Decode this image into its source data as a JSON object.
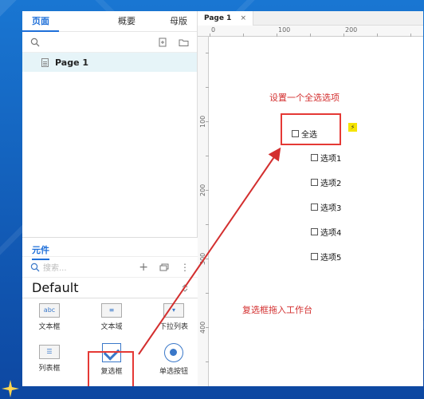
{
  "left_tabs": {
    "pages": "页面",
    "outline": "概要",
    "masters": "母版"
  },
  "pages": [
    {
      "name": "Page 1"
    }
  ],
  "widgets_panel": {
    "tab": "元件",
    "search_placeholder": "搜索...",
    "library": "Default",
    "items": [
      {
        "label": "文本框"
      },
      {
        "label": "文本域"
      },
      {
        "label": "下拉列表"
      },
      {
        "label": "列表框"
      },
      {
        "label": "复选框"
      },
      {
        "label": "单选按钮"
      }
    ]
  },
  "canvas": {
    "tab_title": "Page 1",
    "tab_close": "×",
    "ruler_x": [
      "0",
      "100",
      "200"
    ],
    "ruler_y": [
      "100",
      "200",
      "300",
      "400"
    ],
    "crosshair": "✥"
  },
  "annotations": {
    "top": "设置一个全选选项",
    "bottom": "复选框拖入工作台",
    "color": "#d32f2f"
  },
  "checkboxes": {
    "select_all": "全选",
    "options": [
      "选项1",
      "选项2",
      "选项3",
      "选项4",
      "选项5"
    ]
  },
  "interaction_badge": "⚡"
}
